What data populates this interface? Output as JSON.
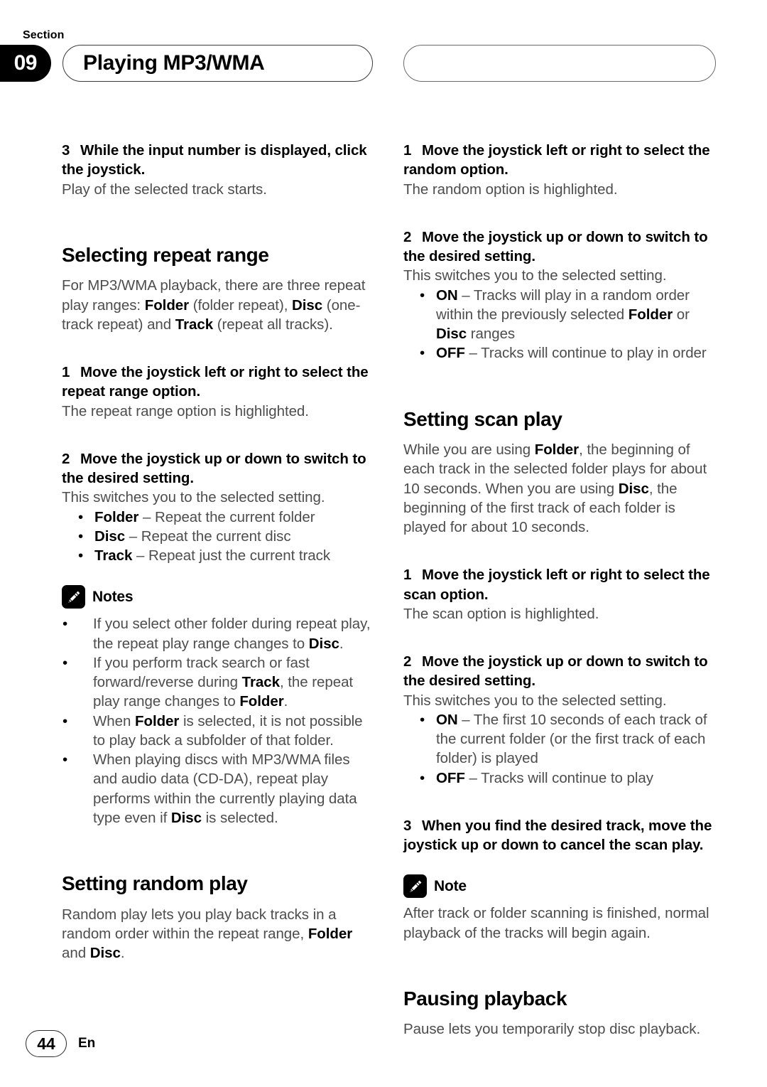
{
  "header": {
    "section_label": "Section",
    "section_number": "09",
    "title": "Playing MP3/WMA"
  },
  "left_column": {
    "step3": {
      "num": "3",
      "text": "While the input number is displayed, click the joystick.",
      "result": "Play of the selected track starts."
    },
    "repeat_heading": "Selecting repeat range",
    "repeat_intro_1": "For MP3/WMA playback, there are three repeat play ranges: ",
    "repeat_intro_b1": "Folder",
    "repeat_intro_2": " (folder repeat), ",
    "repeat_intro_b2": "Disc",
    "repeat_intro_3": " (one-track repeat) and ",
    "repeat_intro_b3": "Track",
    "repeat_intro_4": " (repeat all tracks).",
    "step1": {
      "num": "1",
      "text": "Move the joystick left or right to select the repeat range option.",
      "result": "The repeat range option is highlighted."
    },
    "step2": {
      "num": "2",
      "text": "Move the joystick up or down to switch to the desired setting.",
      "result": "This switches you to the selected setting."
    },
    "repeat_options": [
      {
        "term": "Folder",
        "desc": " – Repeat the current folder"
      },
      {
        "term": "Disc",
        "desc": " – Repeat the current disc"
      },
      {
        "term": "Track",
        "desc": " – Repeat just the current track"
      }
    ],
    "notes_label": "Notes",
    "notes": [
      {
        "p1": "If you select other folder during repeat play, the repeat play range changes to ",
        "b1": "Disc",
        "p2": "."
      },
      {
        "p1": "If you perform track search or fast forward/reverse during ",
        "b1": "Track",
        "p2": ", the repeat play range changes to ",
        "b2": "Folder",
        "p3": "."
      },
      {
        "p1": "When ",
        "b1": "Folder",
        "p2": " is selected, it is not possible to play back a subfolder of that folder."
      },
      {
        "p1": "When playing discs with MP3/WMA files and audio data (CD-DA), repeat play performs within the currently playing data type even if ",
        "b1": "Disc",
        "p2": " is selected."
      }
    ],
    "random_heading": "Setting random play",
    "random_intro_1": "Random play lets you play back tracks in a random order within the repeat range, ",
    "random_intro_b1": "Folder",
    "random_intro_2": " and ",
    "random_intro_b2": "Disc",
    "random_intro_3": "."
  },
  "right_column": {
    "random_step1": {
      "num": "1",
      "text": "Move the joystick left or right to select the random option.",
      "result": "The random option is highlighted."
    },
    "random_step2": {
      "num": "2",
      "text": "Move the joystick up or down to switch to the desired setting.",
      "result": "This switches you to the selected setting."
    },
    "random_options": [
      {
        "term": "ON",
        "d1": " – Tracks will play in a random order within the previously selected ",
        "b1": "Folder",
        "d2": " or ",
        "b2": "Disc",
        "d3": " ranges"
      },
      {
        "term": "OFF",
        "d1": " – Tracks will continue to play in order"
      }
    ],
    "scan_heading": "Setting scan play",
    "scan_intro_1": "While you are using ",
    "scan_intro_b1": "Folder",
    "scan_intro_2": ", the beginning of each track in the selected folder plays for about 10 seconds. When you are using ",
    "scan_intro_b2": "Disc",
    "scan_intro_3": ", the beginning of the first track of each folder is played for about 10 seconds.",
    "scan_step1": {
      "num": "1",
      "text": "Move the joystick left or right to select the scan option.",
      "result": "The scan option is highlighted."
    },
    "scan_step2": {
      "num": "2",
      "text": "Move the joystick up or down to switch to the desired setting.",
      "result": "This switches you to the selected setting."
    },
    "scan_options": [
      {
        "term": "ON",
        "d1": " – The first 10 seconds of each track of the current folder (or the first track of each folder) is played"
      },
      {
        "term": "OFF",
        "d1": " – Tracks will continue to play"
      }
    ],
    "scan_step3": {
      "num": "3",
      "text": "When you find the desired track, move the joystick up or down to cancel the scan play."
    },
    "note_label": "Note",
    "note_text": "After track or folder scanning is finished, normal playback of the tracks will begin again.",
    "pause_heading": "Pausing playback",
    "pause_text": "Pause lets you temporarily stop disc playback."
  },
  "footer": {
    "page_number": "44",
    "language": "En"
  },
  "colors": {
    "body_text": "#4d4d4d",
    "bold_text": "#000000",
    "badge_bg": "#000000"
  }
}
